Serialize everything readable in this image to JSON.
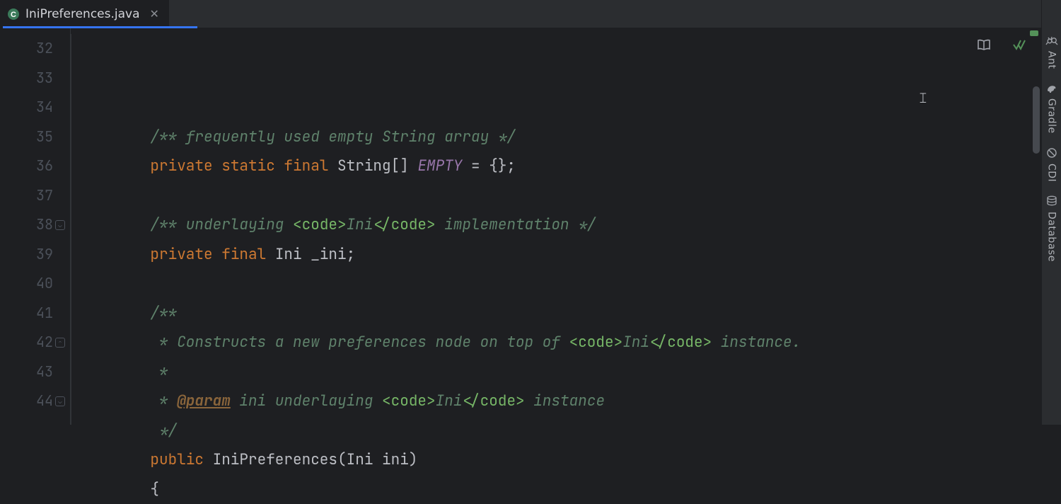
{
  "tab": {
    "filename": "IniPreferences.java",
    "active": true
  },
  "rightTools": [
    {
      "id": "ant",
      "label": "Ant"
    },
    {
      "id": "gradle",
      "label": "Gradle"
    },
    {
      "id": "cdi",
      "label": "CDI"
    },
    {
      "id": "database",
      "label": "Database"
    }
  ],
  "gutter": {
    "start": 32,
    "count": 13
  },
  "code": {
    "lines": [
      {
        "n": 32,
        "segs": [
          {
            "c": "c-doc",
            "t": "/** frequently used empty String array */"
          }
        ]
      },
      {
        "n": 33,
        "segs": [
          {
            "c": "c-kw",
            "t": "private "
          },
          {
            "c": "c-kw",
            "t": "static "
          },
          {
            "c": "c-kw",
            "t": "final "
          },
          {
            "c": "c-type",
            "t": "String[] "
          },
          {
            "c": "c-field",
            "t": "EMPTY"
          },
          {
            "c": "c-punc",
            "t": " = {};"
          }
        ]
      },
      {
        "n": 34,
        "segs": [
          {
            "c": "c-punc",
            "t": ""
          }
        ]
      },
      {
        "n": 35,
        "segs": [
          {
            "c": "c-doc",
            "t": "/** underlaying "
          },
          {
            "c": "c-docmarkup",
            "t": "<code>"
          },
          {
            "c": "c-doc",
            "t": "Ini"
          },
          {
            "c": "c-docmarkup",
            "t": "</code>"
          },
          {
            "c": "c-doc",
            "t": " implementation */"
          }
        ]
      },
      {
        "n": 36,
        "segs": [
          {
            "c": "c-kw",
            "t": "private "
          },
          {
            "c": "c-kw",
            "t": "final "
          },
          {
            "c": "c-type",
            "t": "Ini "
          },
          {
            "c": "c-ident",
            "t": "_ini"
          },
          {
            "c": "c-punc",
            "t": ";"
          }
        ]
      },
      {
        "n": 37,
        "segs": [
          {
            "c": "c-punc",
            "t": ""
          }
        ]
      },
      {
        "n": 38,
        "segs": [
          {
            "c": "c-doc",
            "t": "/**"
          }
        ]
      },
      {
        "n": 39,
        "segs": [
          {
            "c": "c-doc",
            "t": " * Constructs a new preferences node on top of "
          },
          {
            "c": "c-docmarkup",
            "t": "<code>"
          },
          {
            "c": "c-doc",
            "t": "Ini"
          },
          {
            "c": "c-docmarkup",
            "t": "</code>"
          },
          {
            "c": "c-doc",
            "t": " instance."
          }
        ]
      },
      {
        "n": 40,
        "segs": [
          {
            "c": "c-doc",
            "t": " *"
          }
        ]
      },
      {
        "n": 41,
        "segs": [
          {
            "c": "c-doc",
            "t": " * "
          },
          {
            "c": "c-tag",
            "t": "@param"
          },
          {
            "c": "c-doc",
            "t": " ini underlaying "
          },
          {
            "c": "c-docmarkup",
            "t": "<code>"
          },
          {
            "c": "c-doc",
            "t": "Ini"
          },
          {
            "c": "c-docmarkup",
            "t": "</code>"
          },
          {
            "c": "c-doc",
            "t": " instance"
          }
        ]
      },
      {
        "n": 42,
        "segs": [
          {
            "c": "c-doc",
            "t": " */"
          }
        ]
      },
      {
        "n": 43,
        "segs": [
          {
            "c": "c-kw",
            "t": "public "
          },
          {
            "c": "c-type",
            "t": "IniPreferences"
          },
          {
            "c": "c-punc",
            "t": "(Ini ini)"
          }
        ]
      },
      {
        "n": 44,
        "segs": [
          {
            "c": "c-punc",
            "t": "{"
          }
        ]
      }
    ]
  },
  "foldMarks": [
    {
      "line": 38,
      "glyph": "⌄"
    },
    {
      "line": 42,
      "glyph": "⌃"
    },
    {
      "line": 44,
      "glyph": "⌄"
    }
  ],
  "editorStatus": {
    "readerMode": "reader-mode",
    "analysisOk": true
  },
  "caret": {
    "line": 34,
    "rightPx": 160
  },
  "scrollThumb": {
    "topPx": 82,
    "heightPx": 95
  }
}
